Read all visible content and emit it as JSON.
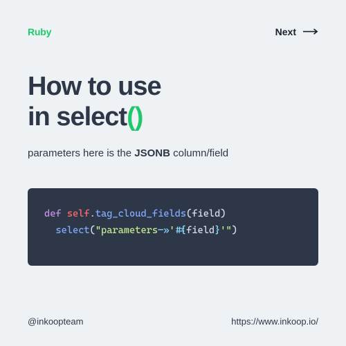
{
  "header": {
    "category": "Ruby",
    "next_label": "Next"
  },
  "title": {
    "line1": "How to use",
    "line2_prefix": "in select",
    "line2_accent": "()"
  },
  "subtitle": {
    "prefix": "parameters here is the ",
    "bold": "JSONB",
    "suffix": " column/field"
  },
  "code": {
    "def": "def",
    "self": "self",
    "dot": ".",
    "method_name": "tag_cloud_fields",
    "lparen": "(",
    "param": "field",
    "rparen": ")",
    "call": "select",
    "call_lparen": "(",
    "str_open": "\"parameters",
    "arrow": "—»",
    "str_mid1": "'",
    "interp_open": "#{",
    "interp_var": "field",
    "interp_close": "}",
    "str_mid2": "'\"",
    "call_rparen": ")"
  },
  "footer": {
    "handle": "@inkoopteam",
    "url": "https://www.inkoop.io/"
  }
}
